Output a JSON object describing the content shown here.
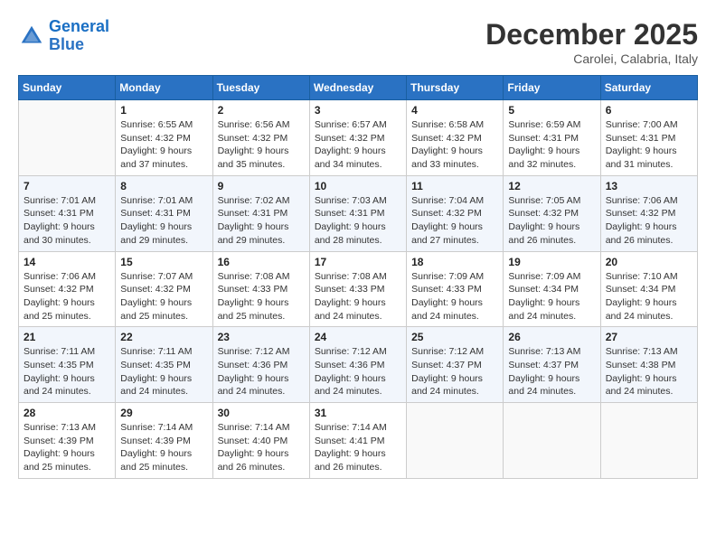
{
  "header": {
    "logo_line1": "General",
    "logo_line2": "Blue",
    "month_year": "December 2025",
    "location": "Carolei, Calabria, Italy"
  },
  "days_of_week": [
    "Sunday",
    "Monday",
    "Tuesday",
    "Wednesday",
    "Thursday",
    "Friday",
    "Saturday"
  ],
  "weeks": [
    [
      {
        "day": "",
        "info": ""
      },
      {
        "day": "1",
        "info": "Sunrise: 6:55 AM\nSunset: 4:32 PM\nDaylight: 9 hours\nand 37 minutes."
      },
      {
        "day": "2",
        "info": "Sunrise: 6:56 AM\nSunset: 4:32 PM\nDaylight: 9 hours\nand 35 minutes."
      },
      {
        "day": "3",
        "info": "Sunrise: 6:57 AM\nSunset: 4:32 PM\nDaylight: 9 hours\nand 34 minutes."
      },
      {
        "day": "4",
        "info": "Sunrise: 6:58 AM\nSunset: 4:32 PM\nDaylight: 9 hours\nand 33 minutes."
      },
      {
        "day": "5",
        "info": "Sunrise: 6:59 AM\nSunset: 4:31 PM\nDaylight: 9 hours\nand 32 minutes."
      },
      {
        "day": "6",
        "info": "Sunrise: 7:00 AM\nSunset: 4:31 PM\nDaylight: 9 hours\nand 31 minutes."
      }
    ],
    [
      {
        "day": "7",
        "info": "Sunrise: 7:01 AM\nSunset: 4:31 PM\nDaylight: 9 hours\nand 30 minutes."
      },
      {
        "day": "8",
        "info": "Sunrise: 7:01 AM\nSunset: 4:31 PM\nDaylight: 9 hours\nand 29 minutes."
      },
      {
        "day": "9",
        "info": "Sunrise: 7:02 AM\nSunset: 4:31 PM\nDaylight: 9 hours\nand 29 minutes."
      },
      {
        "day": "10",
        "info": "Sunrise: 7:03 AM\nSunset: 4:31 PM\nDaylight: 9 hours\nand 28 minutes."
      },
      {
        "day": "11",
        "info": "Sunrise: 7:04 AM\nSunset: 4:32 PM\nDaylight: 9 hours\nand 27 minutes."
      },
      {
        "day": "12",
        "info": "Sunrise: 7:05 AM\nSunset: 4:32 PM\nDaylight: 9 hours\nand 26 minutes."
      },
      {
        "day": "13",
        "info": "Sunrise: 7:06 AM\nSunset: 4:32 PM\nDaylight: 9 hours\nand 26 minutes."
      }
    ],
    [
      {
        "day": "14",
        "info": "Sunrise: 7:06 AM\nSunset: 4:32 PM\nDaylight: 9 hours\nand 25 minutes."
      },
      {
        "day": "15",
        "info": "Sunrise: 7:07 AM\nSunset: 4:32 PM\nDaylight: 9 hours\nand 25 minutes."
      },
      {
        "day": "16",
        "info": "Sunrise: 7:08 AM\nSunset: 4:33 PM\nDaylight: 9 hours\nand 25 minutes."
      },
      {
        "day": "17",
        "info": "Sunrise: 7:08 AM\nSunset: 4:33 PM\nDaylight: 9 hours\nand 24 minutes."
      },
      {
        "day": "18",
        "info": "Sunrise: 7:09 AM\nSunset: 4:33 PM\nDaylight: 9 hours\nand 24 minutes."
      },
      {
        "day": "19",
        "info": "Sunrise: 7:09 AM\nSunset: 4:34 PM\nDaylight: 9 hours\nand 24 minutes."
      },
      {
        "day": "20",
        "info": "Sunrise: 7:10 AM\nSunset: 4:34 PM\nDaylight: 9 hours\nand 24 minutes."
      }
    ],
    [
      {
        "day": "21",
        "info": "Sunrise: 7:11 AM\nSunset: 4:35 PM\nDaylight: 9 hours\nand 24 minutes."
      },
      {
        "day": "22",
        "info": "Sunrise: 7:11 AM\nSunset: 4:35 PM\nDaylight: 9 hours\nand 24 minutes."
      },
      {
        "day": "23",
        "info": "Sunrise: 7:12 AM\nSunset: 4:36 PM\nDaylight: 9 hours\nand 24 minutes."
      },
      {
        "day": "24",
        "info": "Sunrise: 7:12 AM\nSunset: 4:36 PM\nDaylight: 9 hours\nand 24 minutes."
      },
      {
        "day": "25",
        "info": "Sunrise: 7:12 AM\nSunset: 4:37 PM\nDaylight: 9 hours\nand 24 minutes."
      },
      {
        "day": "26",
        "info": "Sunrise: 7:13 AM\nSunset: 4:37 PM\nDaylight: 9 hours\nand 24 minutes."
      },
      {
        "day": "27",
        "info": "Sunrise: 7:13 AM\nSunset: 4:38 PM\nDaylight: 9 hours\nand 24 minutes."
      }
    ],
    [
      {
        "day": "28",
        "info": "Sunrise: 7:13 AM\nSunset: 4:39 PM\nDaylight: 9 hours\nand 25 minutes."
      },
      {
        "day": "29",
        "info": "Sunrise: 7:14 AM\nSunset: 4:39 PM\nDaylight: 9 hours\nand 25 minutes."
      },
      {
        "day": "30",
        "info": "Sunrise: 7:14 AM\nSunset: 4:40 PM\nDaylight: 9 hours\nand 26 minutes."
      },
      {
        "day": "31",
        "info": "Sunrise: 7:14 AM\nSunset: 4:41 PM\nDaylight: 9 hours\nand 26 minutes."
      },
      {
        "day": "",
        "info": ""
      },
      {
        "day": "",
        "info": ""
      },
      {
        "day": "",
        "info": ""
      }
    ]
  ]
}
